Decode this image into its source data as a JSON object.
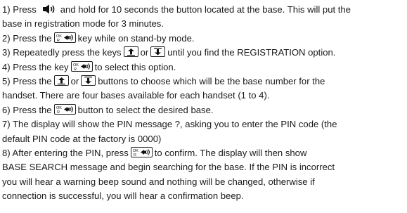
{
  "steps": {
    "s1a": "1) Press",
    "s1b": "and hold for 10 seconds the button located at the base. This will put the",
    "s1c": "base in registration mode for 3 minutes.",
    "s2a": "2) Press the",
    "s2b": "key while on stand-by mode.",
    "s3a": "3) Repeatedly press the keys",
    "s3b": "or",
    "s3c": "until you find the REGISTRATION option.",
    "s4a": "4) Press the  key",
    "s4b": "to select this option.",
    "s5a": "5) Press the",
    "s5b": "or",
    "s5c": "buttons to choose which will be the base number for the",
    "s5d": "handset. There are four bases available for each handset (1 to 4).",
    "s6a": "6) Press the",
    "s6b": "button to select the desired base.",
    "s7a": "7) The display will show the PIN message ?, asking you to enter the PIN code (the",
    "s7b": "default PIN code at the factory is 0000)",
    "s8a": "8) After entering the PIN, press",
    "s8b": "to confirm. The display will then show",
    "s8c": "BASE SEARCH message and begin searching for the base. If the PIN is incorrect",
    "s8d": "you will hear a warning beep sound and nothing will be changed, otherwise if",
    "s8e": "connection is successful, you will hear a confirmation beep."
  },
  "icons": {
    "speaker": "speaker-icon",
    "ok_key": "ok-r-key-icon",
    "up_key": "up-arrow-key-icon",
    "down_key": "down-arrow-key-icon"
  },
  "colors": {
    "text": "#1a1a1a",
    "background": "#ffffff"
  }
}
